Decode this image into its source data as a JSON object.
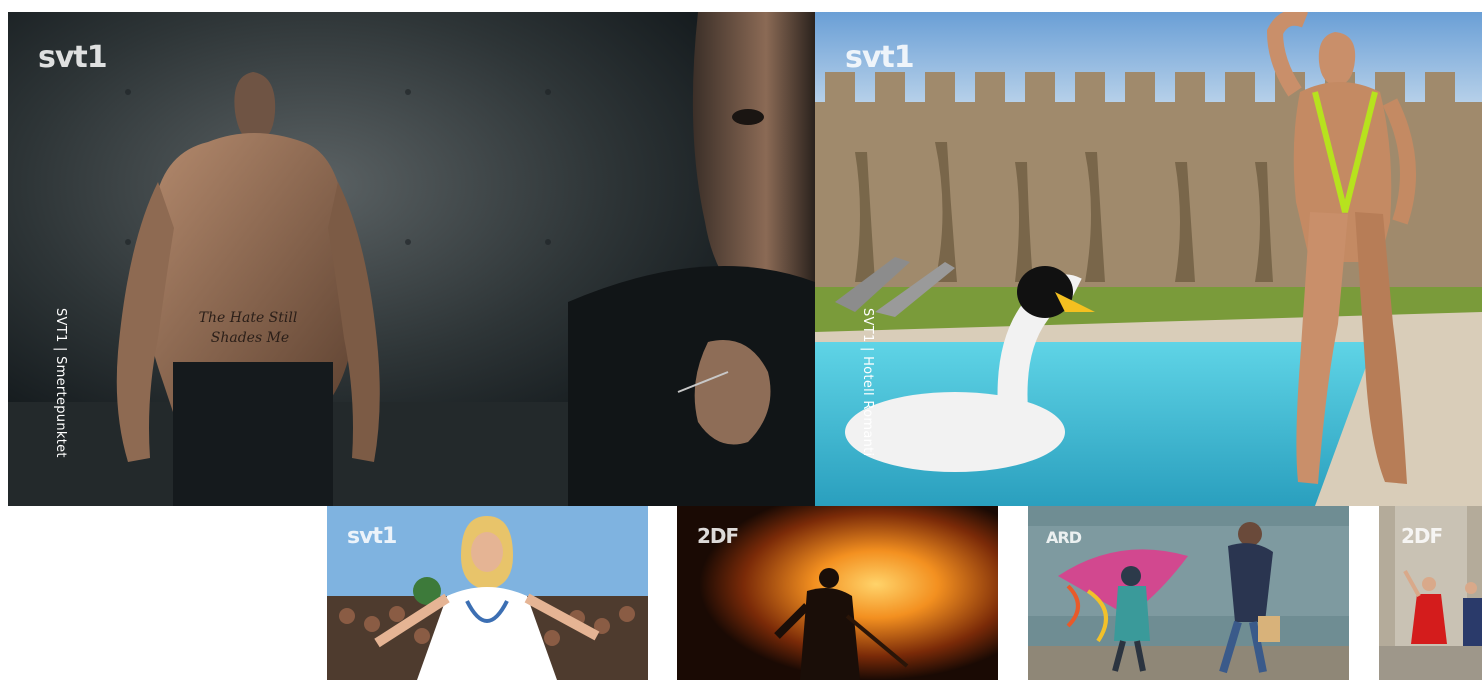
{
  "featured": [
    {
      "channel": "svt1",
      "caption": "SVT1 | Smertepunktet",
      "tattoo_line1": "The Hate Still",
      "tattoo_line2": "Shades Me"
    },
    {
      "channel": "svt1",
      "caption": "SVT1 | Hotell Romanti"
    }
  ],
  "row": [
    {
      "channel": "svt1"
    },
    {
      "channel": "2DF"
    },
    {
      "channel": "ARD"
    },
    {
      "channel": "2DF"
    }
  ],
  "colors": {
    "hero1_dark": "#1a2024",
    "sky": "#9cc2e6",
    "pool": "#46c7dc",
    "fire": "#f39020",
    "sea": "#6f8d93"
  }
}
